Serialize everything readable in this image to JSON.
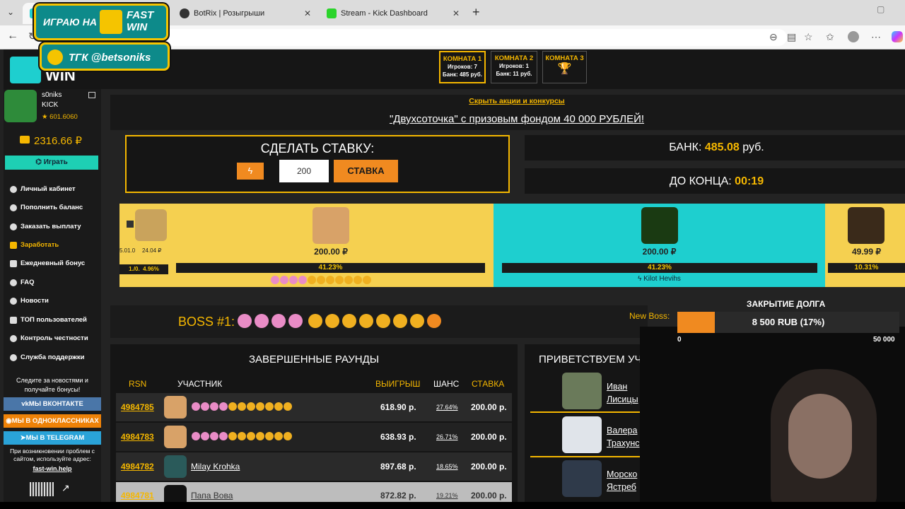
{
  "browser": {
    "tabs": [
      {
        "label": "BotRix | Розыгрыши"
      },
      {
        "label": "Stream - Kick Dashboard"
      }
    ],
    "url": "fast-win.me/?room=1"
  },
  "overlay": {
    "badge1": "ИГРАЮ НА",
    "brand_line1": "FAST",
    "brand_line2": "WIN",
    "badge2": "ТГК @betsoniks"
  },
  "rooms": [
    {
      "title": "КОМНАТА 1",
      "players": "Игроков: 7",
      "bank": "Банк: 485 руб."
    },
    {
      "title": "КОМНАТА 2",
      "players": "Игроков: 1",
      "bank": "Банк: 11 руб."
    },
    {
      "title": "КОМНАТА 3"
    }
  ],
  "logo": "WIN",
  "user": {
    "name": "s0niks",
    "platform": "KICK",
    "rating": "★ 601.6060",
    "balance": "2316.66 ₽",
    "play_button": "Играть"
  },
  "sidebar": {
    "items": [
      "Личный кабинет",
      "Пополнить баланс",
      "Заказать выплату",
      "Заработать",
      "Ежедневный бонус",
      "FAQ",
      "Новости",
      "ТОП пользователей",
      "Контроль честности",
      "Служба поддержки"
    ],
    "follow_text": "Следите за новостями и получайте бонусы!",
    "social": [
      "МЫ ВКОНТАКТЕ",
      "МЫ В ОДНОКЛАССНИКАХ",
      "МЫ В TELEGRAM"
    ],
    "problem_text": "При возникновении проблем с сайтом, используйте адрес:",
    "mirror": "fast-win.help"
  },
  "promo": {
    "hide_link": "Скрыть акции и конкурсы",
    "title": "\"Двухсоточка\" с призовым фондом 40 000 РУБЛЕЙ!"
  },
  "bet": {
    "title": "СДЕЛАТЬ СТАВКУ:",
    "amount": "200",
    "button": "СТАВКА"
  },
  "bank": {
    "label": "БАНК:",
    "value": "485.08",
    "unit": "руб."
  },
  "timer": {
    "label": "ДО КОНЦА:",
    "value": "00:19"
  },
  "players": [
    {
      "amount_a": "5.01.0",
      "amount": "24.04 ₽",
      "pct_a": "1./0.",
      "pct": "4.96%"
    },
    {
      "amount": "200.00 ₽",
      "pct": "41.23%",
      "pct_value": 41.23
    },
    {
      "amount": "200.00 ₽",
      "pct": "41.23%",
      "pct_value": 41.23,
      "name": "Kilot Hevihs"
    },
    {
      "amount": "49.99 ₽",
      "pct": "10.31%",
      "pct_value": 10.31
    }
  ],
  "boss": {
    "label": "BOSS #1:",
    "new_boss": "New Boss:"
  },
  "debt": {
    "title": "ЗАКРЫТИЕ ДОЛГА",
    "value": "8 500 RUB (17%)",
    "progress": 0.17,
    "min": "0",
    "max": "50 000"
  },
  "rounds": {
    "title": "ЗАВЕРШЕННЫЕ РАУНДЫ",
    "headers": {
      "rsn": "RSN",
      "participant": "УЧАСТНИК",
      "win": "ВЫИГРЫШ",
      "chance": "ШАНС",
      "bet": "СТАВКА"
    },
    "rows": [
      {
        "rsn": "4984785",
        "participant": "",
        "win": "618.90 р.",
        "chance": "27.64%",
        "bet": "200.00 р."
      },
      {
        "rsn": "4984783",
        "participant": "",
        "win": "638.93 р.",
        "chance": "26.71%",
        "bet": "200.00 р."
      },
      {
        "rsn": "4984782",
        "participant": "Milay Krohka",
        "win": "897.68 р.",
        "chance": "18.65%",
        "bet": "200.00 р."
      },
      {
        "rsn": "4984781",
        "participant": "Папа Вова",
        "win": "872.82 р.",
        "chance": "19.21%",
        "bet": "200.00 р."
      }
    ]
  },
  "welcome": {
    "title": "ПРИВЕТСТВУЕМ УЧ",
    "users": [
      [
        "Иван",
        "Лисицы"
      ],
      [
        "Валера",
        "Трахунс"
      ],
      [
        "Морско",
        "Ястреб"
      ]
    ]
  }
}
